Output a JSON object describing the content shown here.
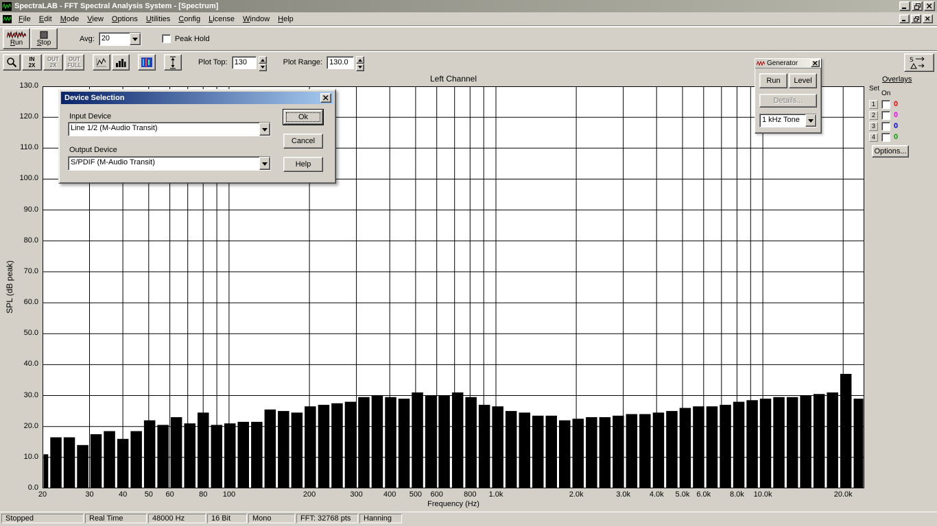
{
  "window": {
    "title": "SpectraLAB - FFT Spectral Analysis System - [Spectrum]"
  },
  "menubar": {
    "items": [
      "File",
      "Edit",
      "Mode",
      "View",
      "Options",
      "Utilities",
      "Config",
      "License",
      "Window",
      "Help"
    ]
  },
  "toolbar1": {
    "run_label": "Run",
    "stop_label": "Stop",
    "avg_label": "Avg:",
    "avg_value": "20",
    "peak_hold_label": "Peak Hold"
  },
  "toolbar2": {
    "zoom_buttons": [
      {
        "line1": "IN",
        "line2": "2X",
        "enabled": true
      },
      {
        "line1": "OUT",
        "line2": "2X",
        "enabled": false
      },
      {
        "line1": "OUT",
        "line2": "FULL",
        "enabled": false
      }
    ],
    "plot_top_label": "Plot Top:",
    "plot_top_value": "130",
    "plot_range_label": "Plot Range:",
    "plot_range_value": "130.0"
  },
  "generator": {
    "title": "Generator",
    "run_label": "Run",
    "level_label": "Level",
    "details_label": "Details...",
    "tone_value": "1 kHz Tone"
  },
  "overlays": {
    "title": "Overlays",
    "col_set": "Set",
    "col_on": "On",
    "options_label": "Options...",
    "rows": [
      {
        "num": "1",
        "value": "0",
        "color": "#ff0000"
      },
      {
        "num": "2",
        "value": "0",
        "color": "#ff00ff"
      },
      {
        "num": "3",
        "value": "0",
        "color": "#0000ff"
      },
      {
        "num": "4",
        "value": "0",
        "color": "#00a000"
      }
    ]
  },
  "dialog": {
    "title": "Device Selection",
    "input_label": "Input Device",
    "input_value": "Line 1/2 (M-Audio Transit)",
    "output_label": "Output Device",
    "output_value": "S/PDIF (M-Audio Transit)",
    "ok_label": "Ok",
    "cancel_label": "Cancel",
    "help_label": "Help"
  },
  "status": {
    "state": "Stopped",
    "mode": "Real Time",
    "sample_rate": "48000 Hz",
    "bit_depth": "16 Bit",
    "channels": "Mono",
    "fft": "FFT: 32768 pts",
    "window": "Hanning"
  },
  "chart_data": {
    "type": "bar",
    "title": "Left Channel",
    "xlabel": "Frequency (Hz)",
    "ylabel": "SPL (dB peak)",
    "x_scale": "log",
    "xlim": [
      20,
      24000
    ],
    "ylim": [
      0,
      130
    ],
    "y_tick_step": 10,
    "grid": true,
    "x_gridlines": [
      20,
      30,
      40,
      50,
      60,
      70,
      80,
      90,
      100,
      200,
      300,
      400,
      500,
      600,
      700,
      800,
      900,
      1000,
      2000,
      3000,
      4000,
      5000,
      6000,
      7000,
      8000,
      9000,
      10000,
      20000
    ],
    "x_ticks": [
      {
        "f": 20,
        "label": "20"
      },
      {
        "f": 30,
        "label": "30"
      },
      {
        "f": 40,
        "label": "40"
      },
      {
        "f": 50,
        "label": "50"
      },
      {
        "f": 60,
        "label": "60"
      },
      {
        "f": 80,
        "label": "80"
      },
      {
        "f": 100,
        "label": "100"
      },
      {
        "f": 200,
        "label": "200"
      },
      {
        "f": 300,
        "label": "300"
      },
      {
        "f": 400,
        "label": "400"
      },
      {
        "f": 500,
        "label": "500"
      },
      {
        "f": 600,
        "label": "600"
      },
      {
        "f": 800,
        "label": "800"
      },
      {
        "f": 1000,
        "label": "1.0k"
      },
      {
        "f": 2000,
        "label": "2.0k"
      },
      {
        "f": 3000,
        "label": "3.0k"
      },
      {
        "f": 4000,
        "label": "4.0k"
      },
      {
        "f": 5000,
        "label": "5.0k"
      },
      {
        "f": 6000,
        "label": "6.0k"
      },
      {
        "f": 8000,
        "label": "8.0k"
      },
      {
        "f": 10000,
        "label": "10.0k"
      },
      {
        "f": 20000,
        "label": "20.0k"
      }
    ],
    "bars": {
      "start_freq": 20,
      "bars_per_octave": 6,
      "unit": "dB SPL peak",
      "values": [
        11,
        16.5,
        16.5,
        14,
        17.5,
        18.5,
        16,
        18.5,
        22,
        20.5,
        23,
        21,
        24.5,
        20.5,
        21,
        21.5,
        21.5,
        25.5,
        25,
        24.5,
        26.5,
        27,
        27.5,
        28,
        29.5,
        30,
        29.5,
        29,
        31,
        30,
        30,
        31,
        29.5,
        27,
        26.5,
        25,
        24.5,
        23.5,
        23.5,
        22,
        22.5,
        23,
        23,
        23.5,
        24,
        24,
        24.5,
        25,
        26,
        26.5,
        26.5,
        27,
        28,
        28.5,
        29,
        29.5,
        29.5,
        30,
        30.5,
        31,
        37,
        29
      ]
    }
  }
}
